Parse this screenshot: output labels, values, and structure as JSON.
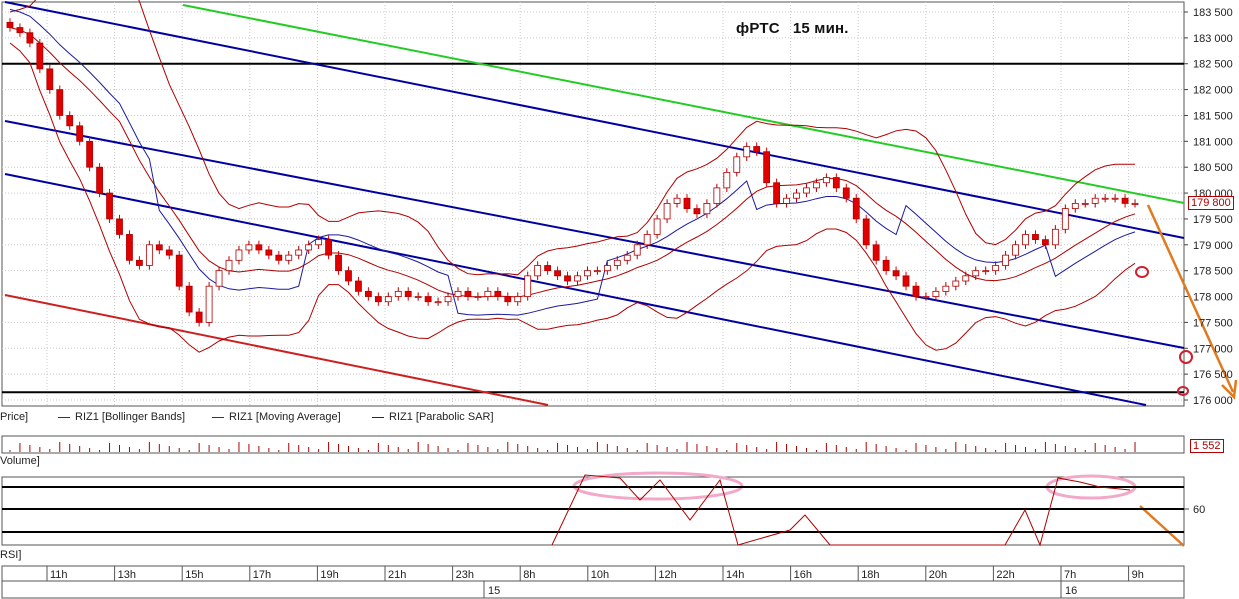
{
  "title": "фРТС   15 мин.",
  "legend": [
    {
      "label": "Price]",
      "color": "#222222"
    },
    {
      "label": "RIZ1 [Bollinger Bands]",
      "color": "#b00000"
    },
    {
      "label": "RIZ1 [Moving Average]",
      "color": "#b00000"
    },
    {
      "label": "RIZ1 [Parabolic SAR]",
      "color": "#1a1aa0"
    }
  ],
  "volume_pane": {
    "label": "Volume]",
    "last_value": "1 552"
  },
  "rsi_pane": {
    "label": "RSI]",
    "level_label": "60"
  },
  "price_axis": {
    "ticks": [
      "183 500",
      "183 000",
      "182 500",
      "182 000",
      "181 500",
      "181 000",
      "180 500",
      "180 000",
      "179 500",
      "179 000",
      "178 500",
      "178 000",
      "177 500",
      "177 000",
      "176 500",
      "176 000"
    ],
    "last_price": "179 800"
  },
  "time_axis": {
    "hours": [
      "11h",
      "13h",
      "15h",
      "17h",
      "19h",
      "21h",
      "23h",
      "8h",
      "10h",
      "12h",
      "14h",
      "16h",
      "18h",
      "20h",
      "22h",
      "7h",
      "9h"
    ],
    "days": [
      "15",
      "16"
    ]
  },
  "colors": {
    "candle_up": "#ffffff",
    "candle_down": "#e00000",
    "channel": "#0000a0",
    "resistance": "#22cc22",
    "support": "#cc2020",
    "forecast": "#e07a20",
    "rsi_highlight": "#f2a8c8"
  },
  "chart_data": {
    "type": "candlestick",
    "symbol": "RIZ1",
    "timeframe": "15 мин.",
    "ylim": [
      176000,
      183600
    ],
    "horizontal_levels": [
      182500,
      176150
    ],
    "closes": [
      183200,
      183100,
      182900,
      182400,
      182000,
      181500,
      181300,
      181000,
      180500,
      180000,
      179500,
      179200,
      178700,
      178600,
      179000,
      178900,
      178800,
      178200,
      177700,
      177500,
      178200,
      178500,
      178700,
      178900,
      179000,
      178900,
      178800,
      178700,
      178800,
      178900,
      179000,
      179100,
      178800,
      178500,
      178300,
      178100,
      178000,
      177900,
      178000,
      178100,
      178000,
      178000,
      177900,
      177900,
      178000,
      178100,
      178000,
      178000,
      178100,
      178000,
      177900,
      178000,
      178400,
      178600,
      178500,
      178400,
      178300,
      178400,
      178500,
      178500,
      178600,
      178700,
      178800,
      179000,
      179200,
      179500,
      179800,
      179900,
      179700,
      179600,
      179800,
      180100,
      180400,
      180700,
      180900,
      180800,
      180200,
      179800,
      179900,
      180000,
      180100,
      180200,
      180300,
      180100,
      179900,
      179500,
      179000,
      178700,
      178500,
      178400,
      178200,
      178000,
      178000,
      178100,
      178200,
      178300,
      178400,
      178500,
      178500,
      178600,
      178800,
      179000,
      179200,
      179100,
      179000,
      179300,
      179700,
      179800,
      179800,
      179900,
      179900,
      179900,
      179800,
      179800
    ]
  }
}
